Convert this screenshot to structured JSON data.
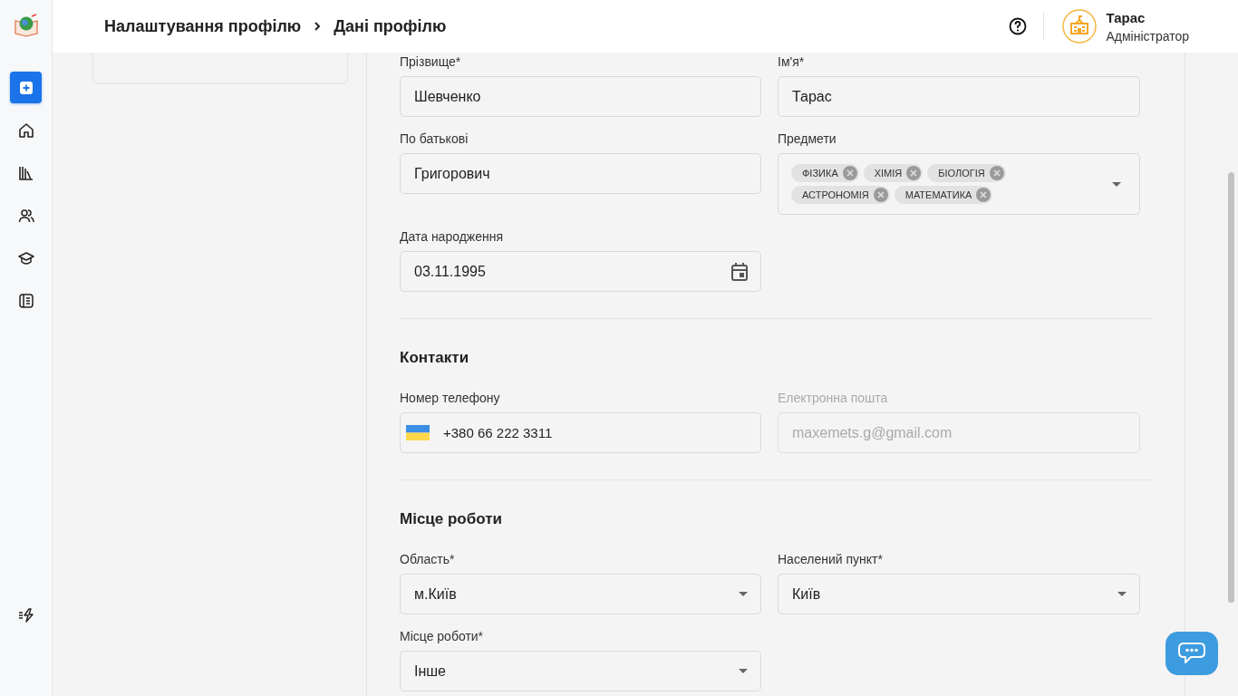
{
  "sidebar": {
    "items": [
      {
        "selected": true
      },
      {
        "selected": false
      },
      {
        "selected": false
      },
      {
        "selected": false
      },
      {
        "selected": false
      },
      {
        "selected": false
      }
    ]
  },
  "breadcrumb": [
    {
      "label": "Налаштування профілю"
    },
    {
      "label": "Дані профілю"
    }
  ],
  "user": {
    "name": "Тарас",
    "role": "Адміністратор"
  },
  "sections": [
    {
      "fields": [
        {
          "kind": "text",
          "label": "Прізвище*",
          "value": "Шевченко",
          "disabled": false
        },
        {
          "kind": "text",
          "label": "Ім'я*",
          "value": "Тарас",
          "disabled": false
        },
        {
          "kind": "text",
          "label": "По батькові",
          "value": "Григорович",
          "disabled": false
        },
        {
          "kind": "tags",
          "label": "Предмети",
          "tags": [
            "ФІЗИКА",
            "ХІМІЯ",
            "БІОЛОГІЯ",
            "АСТРОНОМІЯ",
            "МАТЕМАТИКА"
          ],
          "disabled": false
        },
        {
          "kind": "date",
          "label": "Дата народження",
          "value": "03.11.1995",
          "disabled": false
        }
      ]
    },
    {
      "heading": "Контакти",
      "fields": [
        {
          "kind": "phone",
          "label": "Номер телефону",
          "value": "+380 66 222 3311",
          "disabled": false
        },
        {
          "kind": "text",
          "label": "Електронна пошта",
          "value": "maxemets.g@gmail.com",
          "disabled": true
        }
      ]
    },
    {
      "heading": "Місце роботи",
      "fields": [
        {
          "kind": "select",
          "label": "Область*",
          "value": "м.Київ",
          "disabled": false
        },
        {
          "kind": "select",
          "label": "Населений пункт*",
          "value": "Київ",
          "disabled": false
        },
        {
          "kind": "select",
          "label": "Місце роботи*",
          "value": "Інше",
          "disabled": false
        }
      ]
    }
  ]
}
